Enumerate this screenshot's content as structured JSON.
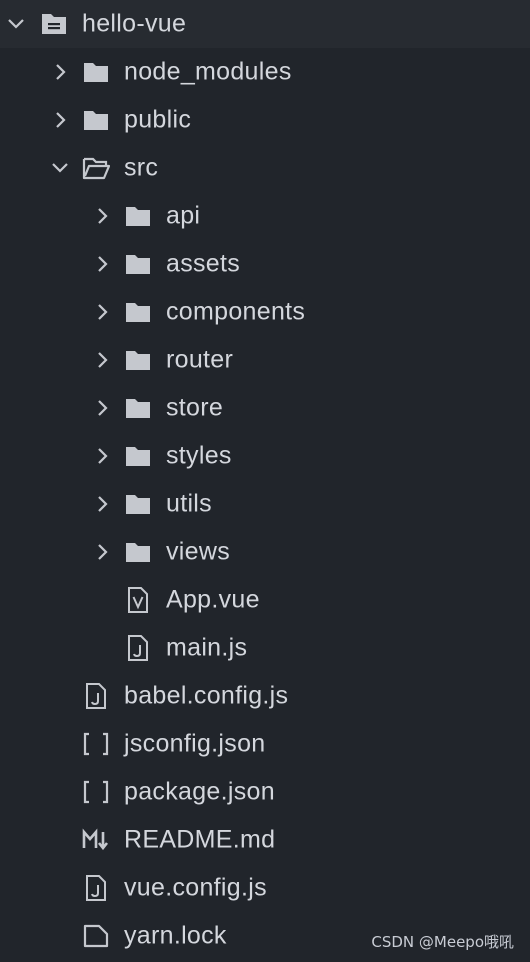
{
  "explorer": {
    "root": {
      "label": "hello-vue",
      "icon": "folder-open-icon"
    },
    "items": [
      {
        "label": "node_modules",
        "icon": "folder-icon"
      },
      {
        "label": "public",
        "icon": "folder-icon"
      },
      {
        "label": "src",
        "icon": "folder-open-icon"
      },
      {
        "label": "api",
        "icon": "folder-icon"
      },
      {
        "label": "assets",
        "icon": "folder-icon"
      },
      {
        "label": "components",
        "icon": "folder-icon"
      },
      {
        "label": "router",
        "icon": "folder-icon"
      },
      {
        "label": "store",
        "icon": "folder-icon"
      },
      {
        "label": "styles",
        "icon": "folder-icon"
      },
      {
        "label": "utils",
        "icon": "folder-icon"
      },
      {
        "label": "views",
        "icon": "folder-icon"
      },
      {
        "label": "App.vue",
        "icon": "vue-file-icon"
      },
      {
        "label": "main.js",
        "icon": "js-file-icon"
      },
      {
        "label": "babel.config.js",
        "icon": "js-file-icon"
      },
      {
        "label": "jsconfig.json",
        "icon": "json-file-icon"
      },
      {
        "label": "package.json",
        "icon": "json-file-icon"
      },
      {
        "label": "README.md",
        "icon": "markdown-file-icon"
      },
      {
        "label": "vue.config.js",
        "icon": "js-file-icon"
      },
      {
        "label": "yarn.lock",
        "icon": "file-icon"
      }
    ]
  },
  "watermark": "CSDN @Meepo哦吼"
}
